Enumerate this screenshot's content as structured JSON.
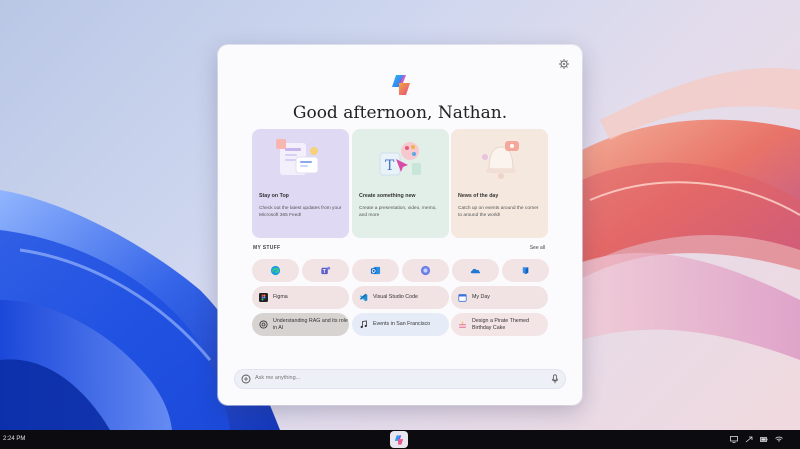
{
  "window": {
    "greeting": "Good afternoon, Nathan.",
    "settings_icon": "gear-icon"
  },
  "cards": [
    {
      "title": "Stay on Top",
      "description": "Check out the latest updates from your Microsoft 365 Feed!",
      "icon": "notes-illustration",
      "color": "#dfd9f3"
    },
    {
      "title": "Create something new",
      "description": "Create a presentation, video, memo, and more",
      "icon": "create-illustration",
      "color": "#e2efe9"
    },
    {
      "title": "News of the day",
      "description": "Catch up on events around the corner to around the world!",
      "icon": "bell-illustration",
      "color": "#f4e8df"
    }
  ],
  "my_stuff": {
    "label": "MY STUFF",
    "see_all": "See all",
    "apps": [
      "edge-icon",
      "teams-icon",
      "outlook-icon",
      "copilot-icon",
      "onedrive-icon",
      "azure-icon"
    ],
    "items": [
      {
        "label": "Figma",
        "icon": "figma-icon"
      },
      {
        "label": "Visual Studio Code",
        "icon": "vscode-icon"
      },
      {
        "label": "My Day",
        "icon": "calendar-icon"
      },
      {
        "label": "Understanding RAG and its role in AI",
        "icon": "openai-icon"
      },
      {
        "label": "Events in San Francisco",
        "icon": "music-icon"
      },
      {
        "label": "Design a Pirate Themed Birthday Cake",
        "icon": "cake-icon"
      }
    ]
  },
  "chat": {
    "placeholder": "Ask me anything...",
    "mic_icon": "microphone-icon"
  },
  "taskbar": {
    "time": "2:24 PM",
    "tray_icons": [
      "display-icon",
      "share-icon",
      "battery-icon",
      "wifi-icon"
    ]
  },
  "colors": {
    "window_bg": "#fbfafc",
    "pill_bg": "#f2e3e5",
    "taskbar_bg": "#0c0c10"
  }
}
